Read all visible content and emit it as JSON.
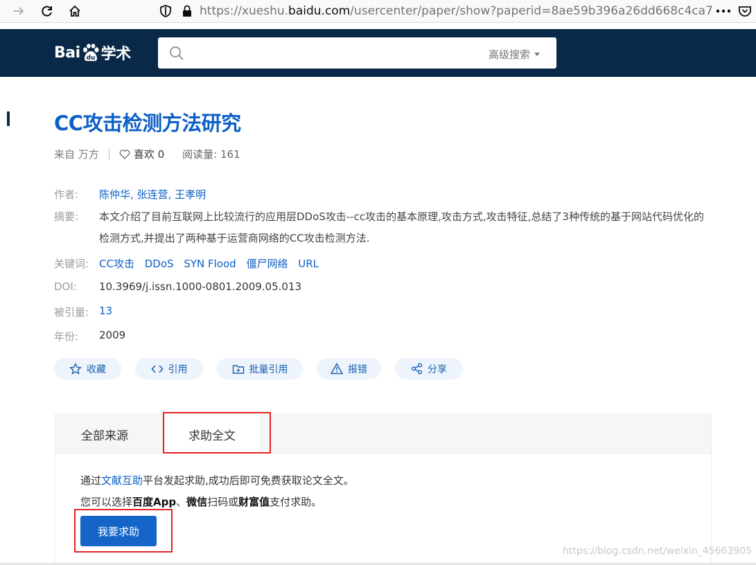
{
  "browser": {
    "url_prefix": "https://xueshu.",
    "url_domain": "baidu.com",
    "url_suffix": "/usercenter/paper/show?paperid=8ae59b396a26dd668c4ca7"
  },
  "header": {
    "logo_text_left": "Bai",
    "logo_text_du": "du",
    "logo_text_right": "学术",
    "search_placeholder": "",
    "advanced_search": "高级搜索"
  },
  "paper": {
    "title": "CC攻击检测方法研究",
    "source_label": "来自",
    "source": "万方",
    "like_label": "喜欢",
    "like_count": "0",
    "reads_label": "阅读量:",
    "reads_count": "161",
    "authors_label": "作者:",
    "authors": "陈仲华, 张连营, 王孝明",
    "abstract_label": "摘要:",
    "abstract": "本文介绍了目前互联网上比较流行的应用层DDoS攻击--cc攻击的基本原理,攻击方式,攻击特征,总结了3种传统的基于网站代码优化的检测方式,并提出了两种基于运营商网络的CC攻击检测方法.",
    "keywords_label": "关键词:",
    "keywords": [
      "CC攻击",
      "DDoS",
      "SYN Flood",
      "僵尸网络",
      "URL"
    ],
    "doi_label": "DOI:",
    "doi": "10.3969/j.issn.1000-0801.2009.05.013",
    "cited_label": "被引量:",
    "cited": "13",
    "year_label": "年份:",
    "year": "2009"
  },
  "actions": [
    {
      "label": "收藏",
      "icon": "star-icon"
    },
    {
      "label": "引用",
      "icon": "code-icon"
    },
    {
      "label": "批量引用",
      "icon": "folder-plus-icon"
    },
    {
      "label": "报错",
      "icon": "warning-icon"
    },
    {
      "label": "分享",
      "icon": "share-icon"
    }
  ],
  "tabs": {
    "all_sources": "全部来源",
    "request_fulltext": "求助全文"
  },
  "panel": {
    "line1_a": "通过",
    "line1_link": "文献互助",
    "line1_b": "平台发起求助,成功后即可免费获取论文全文。",
    "line2_a": "您可以选择",
    "line2_b1": "百度App",
    "line2_sep": "、",
    "line2_b2": "微信",
    "line2_c": "扫码或",
    "line2_b3": "财富值",
    "line2_d": "支付求助。",
    "help_button": "我要求助"
  },
  "watermark": "https://blog.csdn.net/weixin_45663905",
  "colors": {
    "header_bg": "#0a2949",
    "link_blue": "#0b5fc7",
    "button_blue": "#1565c9",
    "highlight_red": "#e52222"
  }
}
